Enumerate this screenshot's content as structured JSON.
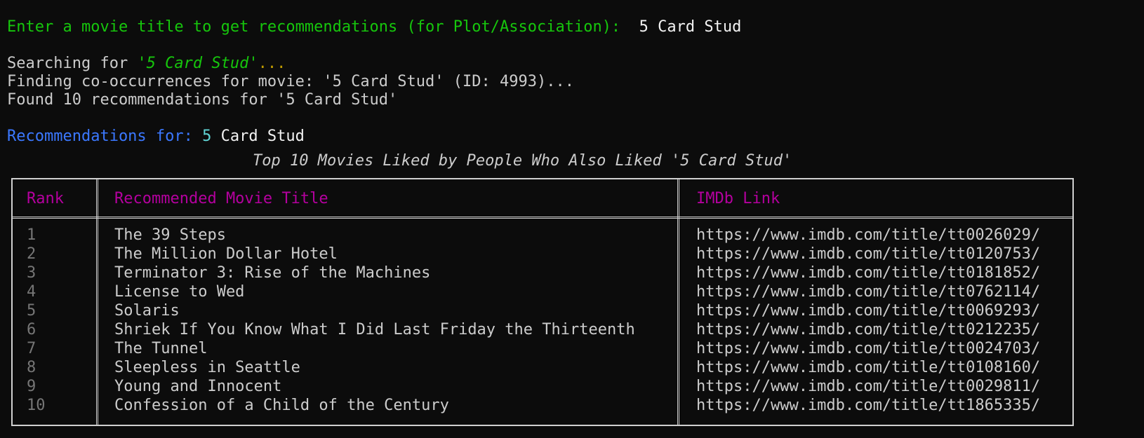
{
  "prompt": {
    "label": "Enter a movie title to get recommendations (for Plot/Association): ",
    "value": " 5 Card Stud"
  },
  "status": {
    "searching_prefix": "Searching for ",
    "searching_query": "'5 Card Stud'",
    "searching_suffix": "...",
    "cooccurrence": "Finding co-occurrences for movie: '5 Card Stud' (ID: 4993)...",
    "found": "Found 10 recommendations for '5 Card Stud'"
  },
  "results_heading": {
    "label": "Recommendations for: ",
    "number": "5",
    "rest": " Card Stud"
  },
  "table": {
    "caption": "Top 10 Movies Liked by People Who Also Liked '5 Card Stud'",
    "headers": [
      "Rank",
      "Recommended Movie Title",
      "IMDb Link"
    ],
    "rows": [
      {
        "rank": "1",
        "title": "The 39 Steps",
        "link": "https://www.imdb.com/title/tt0026029/"
      },
      {
        "rank": "2",
        "title": "The Million Dollar Hotel",
        "link": "https://www.imdb.com/title/tt0120753/"
      },
      {
        "rank": "3",
        "title": "Terminator 3: Rise of the Machines",
        "link": "https://www.imdb.com/title/tt0181852/"
      },
      {
        "rank": "4",
        "title": "License to Wed",
        "link": "https://www.imdb.com/title/tt0762114/"
      },
      {
        "rank": "5",
        "title": "Solaris",
        "link": "https://www.imdb.com/title/tt0069293/"
      },
      {
        "rank": "6",
        "title": "Shriek If You Know What I Did Last Friday the Thirteenth",
        "link": "https://www.imdb.com/title/tt0212235/"
      },
      {
        "rank": "7",
        "title": "The Tunnel",
        "link": "https://www.imdb.com/title/tt0024703/"
      },
      {
        "rank": "8",
        "title": "Sleepless in Seattle",
        "link": "https://www.imdb.com/title/tt0108160/"
      },
      {
        "rank": "9",
        "title": "Young and Innocent",
        "link": "https://www.imdb.com/title/tt0029811/"
      },
      {
        "rank": "10",
        "title": "Confession of a Child of the Century",
        "link": "https://www.imdb.com/title/tt1865335/"
      }
    ]
  },
  "colors": {
    "background": "#0c0c0c",
    "prompt_green": "#16c60c",
    "ellipsis_yellow": "#c19c00",
    "heading_blue": "#3b78ff",
    "number_cyan": "#61d6d6",
    "header_magenta": "#b4009e",
    "rank_gray": "#767676",
    "text": "#cccccc"
  }
}
